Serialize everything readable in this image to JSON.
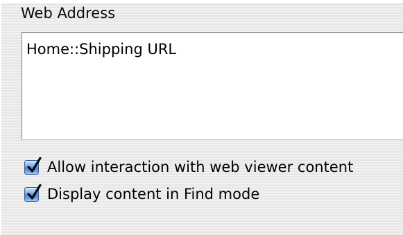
{
  "section": {
    "label": "Web Address"
  },
  "web_address_field": {
    "value": "Home::Shipping URL"
  },
  "options": [
    {
      "label": "Allow interaction with web viewer content",
      "checked": true
    },
    {
      "label": "Display content in Find mode",
      "checked": true
    }
  ],
  "colors": {
    "checkbox_fill": "#4f86d6",
    "panel_background": "#ececec"
  },
  "icons": {
    "checkmark": "checkmark-icon"
  }
}
